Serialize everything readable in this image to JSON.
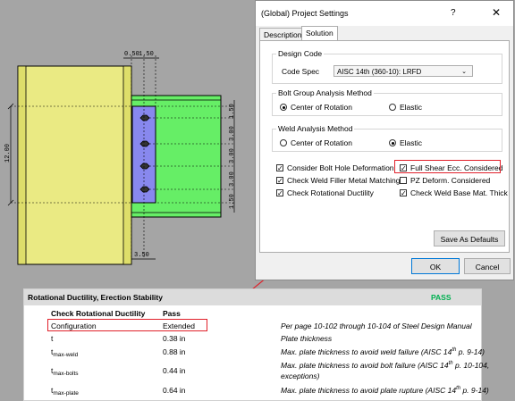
{
  "drawing": {
    "dim_top_left": "0.50",
    "dim_top_right": "1.50",
    "dim_left": "12.00",
    "dim_right_1": "1.50",
    "dim_right_2": "3.00",
    "dim_right_3": "3.00",
    "dim_right_4": "3.00",
    "dim_right_5": "1.50",
    "dim_bottom": "3.50"
  },
  "dialog": {
    "title": "(Global) Project Settings",
    "help_glyph": "?",
    "close_glyph": "✕",
    "tabs": [
      "Description",
      "Solution"
    ],
    "design_code": {
      "legend": "Design Code",
      "label": "Code Spec",
      "value": "AISC 14th (360-10): LRFD"
    },
    "bolt_group": {
      "legend": "Bolt Group Analysis Method",
      "options": [
        "Center of Rotation",
        "Elastic"
      ],
      "selected": "Center of Rotation"
    },
    "weld": {
      "legend": "Weld Analysis Method",
      "options": [
        "Center of Rotation",
        "Elastic"
      ],
      "selected": "Elastic"
    },
    "checks": [
      {
        "label": "Consider Bolt Hole Deformation",
        "checked": true
      },
      {
        "label": "Full Shear Ecc. Considered",
        "checked": true
      },
      {
        "label": "Check Weld Filler Metal Matching",
        "checked": true
      },
      {
        "label": "PZ Deform. Considered",
        "checked": false
      },
      {
        "label": "Check Rotational Ductility",
        "checked": true
      },
      {
        "label": "Check Weld Base Mat. Thick",
        "checked": true
      }
    ],
    "save_defaults": "Save As Defaults",
    "ok": "OK",
    "cancel": "Cancel"
  },
  "report": {
    "title": "Rotational Ductility, Erection Stability",
    "status": "PASS",
    "rows": [
      {
        "name": "Check Rotational Ductility",
        "value": "Pass",
        "note": ""
      },
      {
        "name": "Configuration",
        "value": "Extended",
        "note": "Per page 10-102 through 10-104 of Steel Design Manual"
      },
      {
        "name": "t",
        "sub": "",
        "value": "0.38 in",
        "note": "Plate thickness"
      },
      {
        "name": "t",
        "sub": "max-weld",
        "value": "0.88 in",
        "note_pre": "Max. plate thickness to avoid weld failure (AISC 14",
        "note_sup": "th",
        "note_post": " p. 9-14)"
      },
      {
        "name": "t",
        "sub": "max-bolts",
        "value": "0.44 in",
        "note_pre": "Max. plate thickness to avoid bolt failure (AISC 14",
        "note_sup": "th",
        "note_post": " p. 10-104,",
        "note_line2": "exceptions)"
      },
      {
        "name": "t",
        "sub": "max-plate",
        "value": "0.64 in",
        "note_pre": "Max. plate thickness to avoid plate rupture (AISC 14",
        "note_sup": "th",
        "note_post": " p. 9-14)"
      }
    ]
  },
  "colors": {
    "beam_yellow": "#eaea83",
    "plate_blue": "#8888ee",
    "girder_green": "#66ee66",
    "highlight_red": "#e0202a",
    "pass_green": "#00b050",
    "canvas_gray": "#a5a5a5"
  }
}
